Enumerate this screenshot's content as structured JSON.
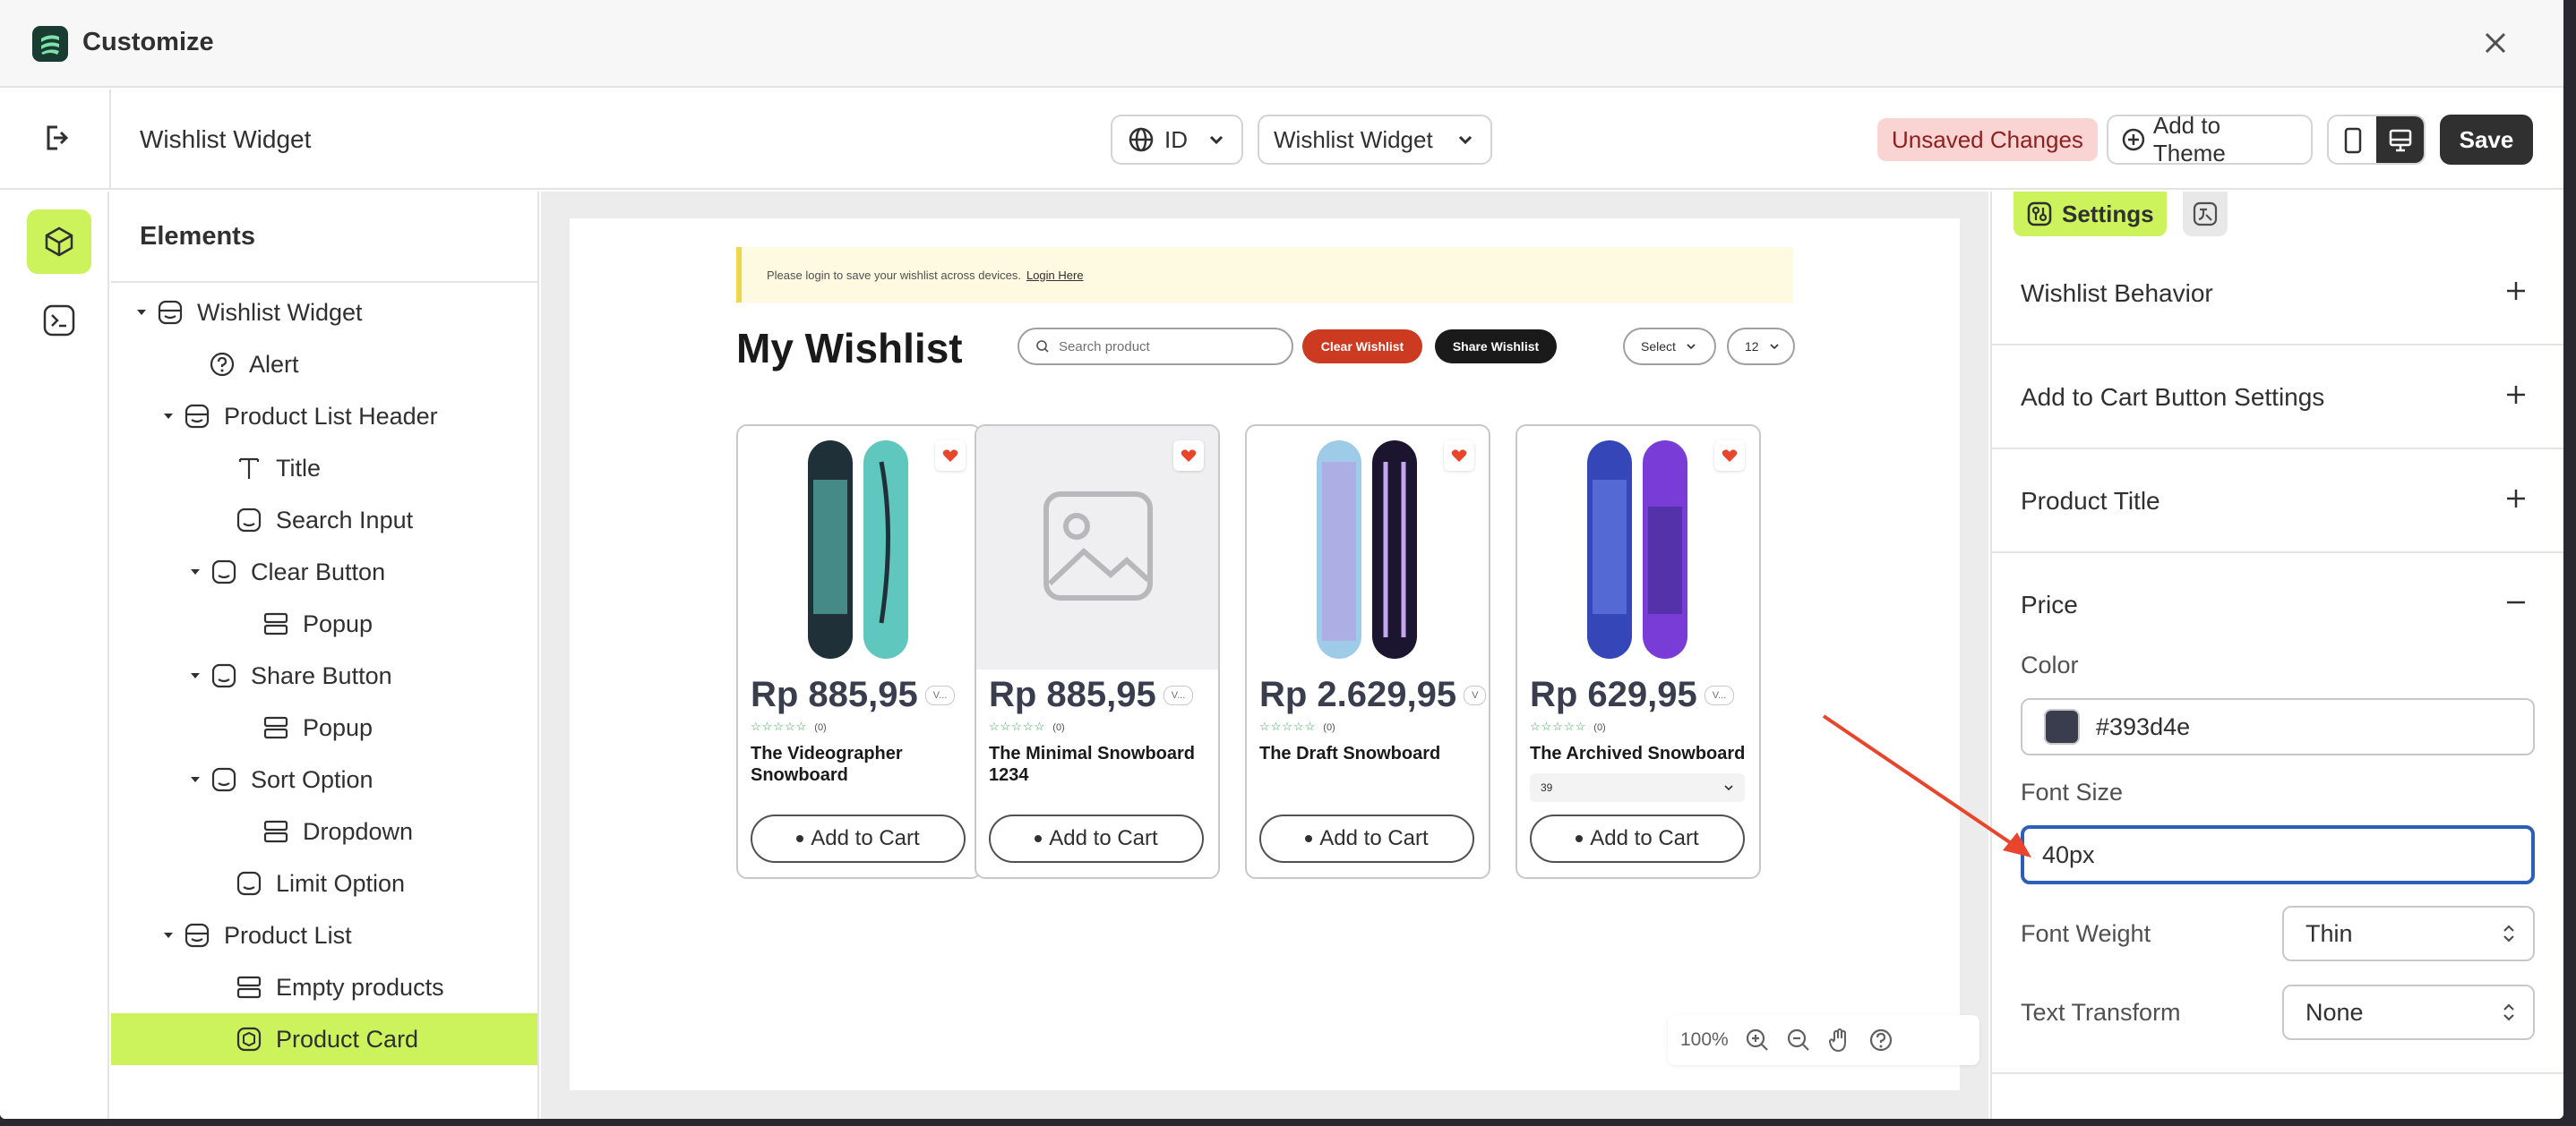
{
  "titlebar": {
    "title": "Customize"
  },
  "topbar": {
    "page_title": "Wishlist Widget",
    "language": "ID",
    "template": "Wishlist Widget",
    "unsaved": "Unsaved Changes",
    "add_to_theme": "Add to Theme",
    "save": "Save"
  },
  "tree": {
    "heading": "Elements",
    "nodes": [
      {
        "label": "Wishlist Widget"
      },
      {
        "label": "Alert"
      },
      {
        "label": "Product List Header"
      },
      {
        "label": "Title"
      },
      {
        "label": "Search Input"
      },
      {
        "label": "Clear Button"
      },
      {
        "label": "Popup"
      },
      {
        "label": "Share Button"
      },
      {
        "label": "Popup"
      },
      {
        "label": "Sort Option"
      },
      {
        "label": "Dropdown"
      },
      {
        "label": "Limit Option"
      },
      {
        "label": "Product List"
      },
      {
        "label": "Empty products"
      },
      {
        "label": "Product Card"
      }
    ]
  },
  "preview": {
    "alert_text": "Please login to save your wishlist across devices.",
    "alert_link": "Login Here",
    "title": "My Wishlist",
    "search_placeholder": "Search product",
    "clear_label": "Clear Wishlist",
    "share_label": "Share Wishlist",
    "sort_label": "Select",
    "limit_label": "12",
    "cards": [
      {
        "price": "Rp 885,95",
        "badge": "V...",
        "reviews": "(0)",
        "name": "The Videographer Snowboard",
        "cta": "Add to Cart"
      },
      {
        "price": "Rp 885,95",
        "badge": "V...",
        "reviews": "(0)",
        "name": "The Minimal Snowboard 1234",
        "cta": "Add to Cart"
      },
      {
        "price": "Rp 2.629,95",
        "badge": "V",
        "reviews": "(0)",
        "name": "The Draft Snowboard",
        "cta": "Add to Cart"
      },
      {
        "price": "Rp 629,95",
        "badge": "V...",
        "reviews": "(0)",
        "name": "The Archived Snowboard",
        "variant": "39",
        "cta": "Add to Cart"
      }
    ]
  },
  "zoom": {
    "level": "100%"
  },
  "panel": {
    "tab_settings": "Settings",
    "sections": [
      {
        "title": "Wishlist Behavior"
      },
      {
        "title": "Add to Cart Button Settings"
      },
      {
        "title": "Product Title"
      },
      {
        "title": "Price"
      }
    ],
    "color_label": "Color",
    "color_value": "#393d4e",
    "font_size_label": "Font Size",
    "font_size_value": "40px",
    "font_weight_label": "Font Weight",
    "font_weight_value": "Thin",
    "text_transform_label": "Text Transform",
    "text_transform_value": "None"
  },
  "colors": {
    "accent": "#ccf25c",
    "price_color": "#393d4e",
    "focus": "#2c5fb8",
    "annotation_arrow": "#e8452c"
  }
}
